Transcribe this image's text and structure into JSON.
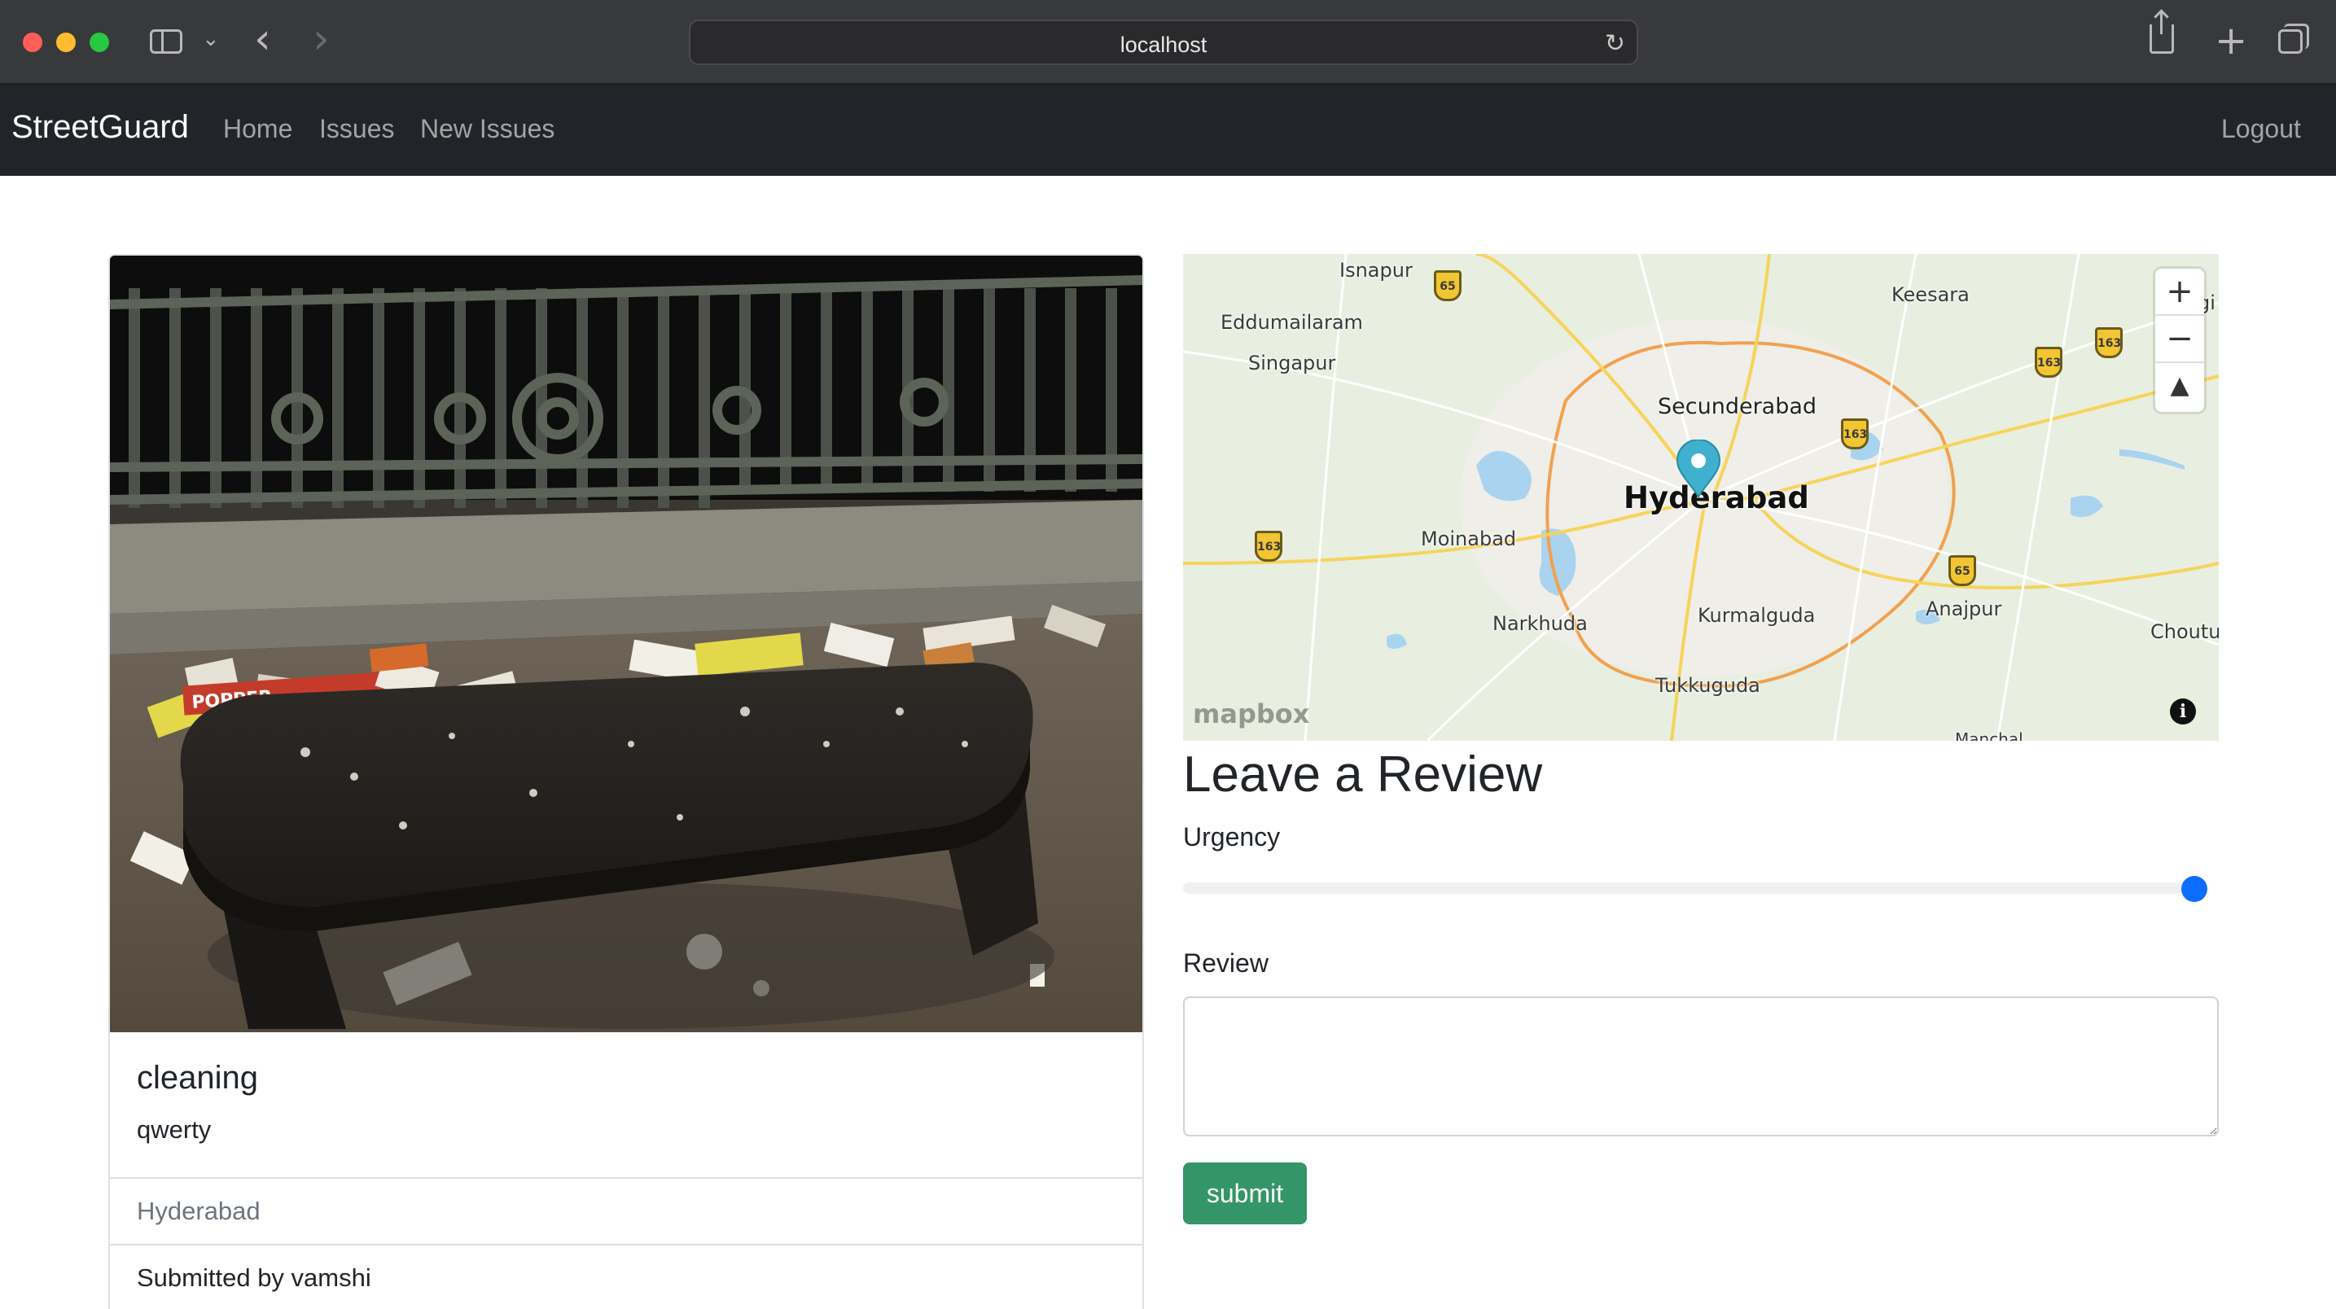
{
  "browser": {
    "address": "localhost"
  },
  "navbar": {
    "brand": "StreetGuard",
    "links": [
      "Home",
      "Issues",
      "New Issues"
    ],
    "logout": "Logout"
  },
  "issue": {
    "title": "cleaning",
    "description": "qwerty",
    "location": "Hyderabad",
    "submitted_by": "Submitted by vamshi",
    "photo_text": "POPPER"
  },
  "map": {
    "labels": {
      "hyderabad": "Hyderabad",
      "secunderabad": "Secunderabad",
      "isnapur": "Isnapur",
      "eddumailaram": "Eddumailaram",
      "singapur": "Singapur",
      "keesara": "Keesara",
      "moinabad": "Moinabad",
      "narkhuda": "Narkhuda",
      "kurmalguda": "Kurmalguda",
      "anajpur": "Anajpur",
      "tukkuguda": "Tukkuguda",
      "choutup": "Choutup",
      "gi": "gi",
      "manchal": "Manchal"
    },
    "shields": {
      "nh65": "65",
      "nh163": "163"
    },
    "controls": {
      "zoom_in": "+",
      "zoom_out": "−",
      "compass": "▲"
    },
    "attribution": "mapbox",
    "info": "i"
  },
  "review": {
    "heading": "Leave a Review",
    "urgency_label": "Urgency",
    "urgency_value": 100,
    "urgency_max": 100,
    "review_label": "Review",
    "review_value": "",
    "submit_label": "submit"
  },
  "colors": {
    "navbar_bg": "#212529",
    "submit_bg": "#198754",
    "range_thumb": "#0d6efd",
    "marker": "#3fb1ce"
  }
}
